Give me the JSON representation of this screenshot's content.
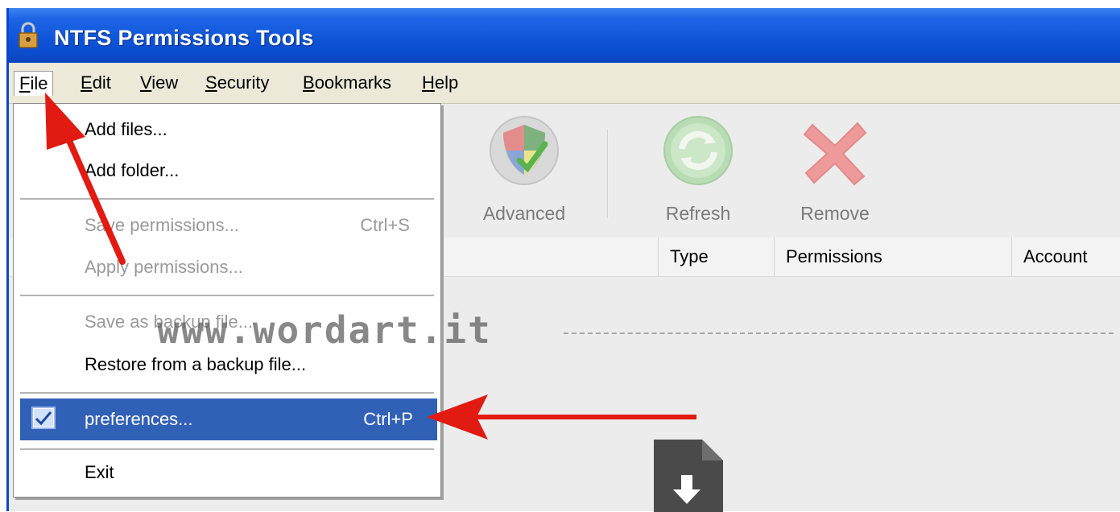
{
  "window": {
    "title": "NTFS Permissions Tools"
  },
  "menubar": {
    "items": [
      {
        "label": "File",
        "ul": "F",
        "rest": "ile"
      },
      {
        "label": "Edit",
        "ul": "E",
        "rest": "dit"
      },
      {
        "label": "View",
        "ul": "V",
        "rest": "iew"
      },
      {
        "label": "Security",
        "ul": "S",
        "rest": "ecurity"
      },
      {
        "label": "Bookmarks",
        "ul": "B",
        "rest": "ookmarks"
      },
      {
        "label": "Help",
        "ul": "H",
        "rest": "elp"
      }
    ]
  },
  "file_menu": {
    "items": [
      {
        "label": "Add files...",
        "shortcut": "",
        "state": "enabled"
      },
      {
        "label": "Add folder...",
        "shortcut": "",
        "state": "enabled"
      },
      {
        "label": "Save permissions...",
        "shortcut": "Ctrl+S",
        "state": "disabled"
      },
      {
        "label": "Apply permissions...",
        "shortcut": "",
        "state": "disabled"
      },
      {
        "label": "Save as backup file...",
        "shortcut": "",
        "state": "disabled"
      },
      {
        "label": "Restore from a backup file...",
        "shortcut": "",
        "state": "enabled"
      },
      {
        "label": "preferences...",
        "shortcut": "Ctrl+P",
        "state": "selected"
      },
      {
        "label": "Exit",
        "shortcut": "",
        "state": "enabled"
      }
    ]
  },
  "toolbar": {
    "advanced_label": "Advanced",
    "refresh_label": "Refresh",
    "remove_label": "Remove"
  },
  "columns": {
    "type": "Type",
    "permissions": "Permissions",
    "account": "Account"
  },
  "watermark": "www.wordart.it",
  "colors": {
    "titlebar": "#0f55d9",
    "selection": "#3160b7",
    "arrow": "#e21b12"
  }
}
